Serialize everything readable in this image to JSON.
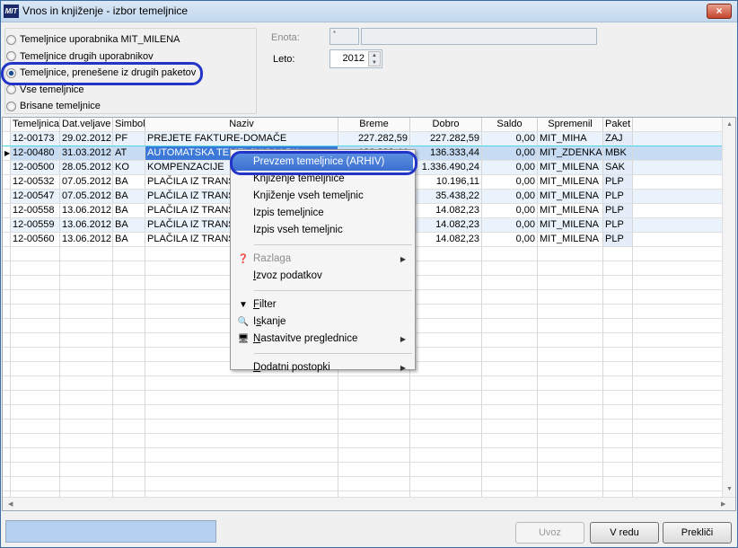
{
  "window": {
    "title": "Vnos in knjiženje - izbor temeljnice",
    "logo": "MIT",
    "close_icon": "×"
  },
  "filter": {
    "options": [
      {
        "label": "Temeljnice uporabnika MIT_MILENA",
        "selected": false
      },
      {
        "label": "Temeljnice drugih uporabnikov",
        "selected": false
      },
      {
        "label": "Temeljnice, prenešene iz drugih paketov",
        "selected": true
      },
      {
        "label": "Vse temeljnice",
        "selected": false
      },
      {
        "label": "Brisane temeljnice",
        "selected": false
      }
    ],
    "enota_label": "Enota:",
    "enota_code": "*",
    "enota_name": "",
    "leto_label": "Leto:",
    "leto_value": "2012"
  },
  "grid": {
    "columns": [
      "Temeljnica",
      "Dat.veljave",
      "Simbol",
      "Naziv",
      "Breme",
      "Dobro",
      "Saldo",
      "Spremenil",
      "Paket"
    ],
    "rows": [
      [
        "12-00173",
        "29.02.2012",
        "PF",
        "PREJETE FAKTURE-DOMAČE",
        "227.282,59",
        "227.282,59",
        "0,00",
        "MIT_MIHA",
        "ZAJ"
      ],
      [
        "12-00480",
        "31.03.2012",
        "AT",
        "AUTOMATSKA TEMELJNICA LPK",
        "136.333,44",
        "136.333,44",
        "0,00",
        "MIT_ZDENKA",
        "MBK"
      ],
      [
        "12-00500",
        "28.05.2012",
        "KO",
        "KOMPENZACIJE",
        "",
        "1.336.490,24",
        "0,00",
        "MIT_MILENA",
        "SAK"
      ],
      [
        "12-00532",
        "07.05.2012",
        "BA",
        "PLAČILA IZ TRANS",
        "",
        "10.196,11",
        "0,00",
        "MIT_MILENA",
        "PLP"
      ],
      [
        "12-00547",
        "07.05.2012",
        "BA",
        "PLAČILA IZ TRANS",
        "",
        "35.438,22",
        "0,00",
        "MIT_MILENA",
        "PLP"
      ],
      [
        "12-00558",
        "13.06.2012",
        "BA",
        "PLAČILA IZ TRANS",
        "",
        "14.082,23",
        "0,00",
        "MIT_MILENA",
        "PLP"
      ],
      [
        "12-00559",
        "13.06.2012",
        "BA",
        "PLAČILA IZ TRANS",
        "",
        "14.082,23",
        "0,00",
        "MIT_MILENA",
        "PLP"
      ],
      [
        "12-00560",
        "13.06.2012",
        "BA",
        "PLAČILA IZ TRANS",
        "",
        "14.082,23",
        "0,00",
        "MIT_MILENA",
        "PLP"
      ]
    ],
    "selected_row": 1
  },
  "context_menu": {
    "items": [
      {
        "label": "Prevzem temeljnice (ARHIV)",
        "highlighted": true
      },
      {
        "label": "Knjiženje temeljnice"
      },
      {
        "label": "Knjiženje vseh temeljnic"
      },
      {
        "label": "Izpis temeljnice"
      },
      {
        "label": "Izpis vseh temeljnic"
      },
      {
        "separator": true
      },
      {
        "label": "Razlaga",
        "disabled": true,
        "submenu": true,
        "icon": "help-icon"
      },
      {
        "label": "Izvoz podatkov",
        "accel": "I"
      },
      {
        "separator": true
      },
      {
        "label": "Filter",
        "accel": "F",
        "icon": "filter-icon"
      },
      {
        "label": "Iskanje",
        "accel": "s",
        "icon": "search-icon"
      },
      {
        "label": "Nastavitve preglednice",
        "accel": "N",
        "submenu": true,
        "icon": "settings-icon"
      },
      {
        "separator": true
      },
      {
        "label": "Dodatni postopki",
        "accel": "D",
        "submenu": true
      }
    ]
  },
  "footer": {
    "uvoz": "Uvoz",
    "v_redu": "V redu",
    "preklici": "Prekliči"
  },
  "colors": {
    "annotation": "#2235c8",
    "selected_row": "#c7dbf2",
    "alt_row": "#eaf2fc",
    "menu_highlight": "#3c6fd0"
  }
}
